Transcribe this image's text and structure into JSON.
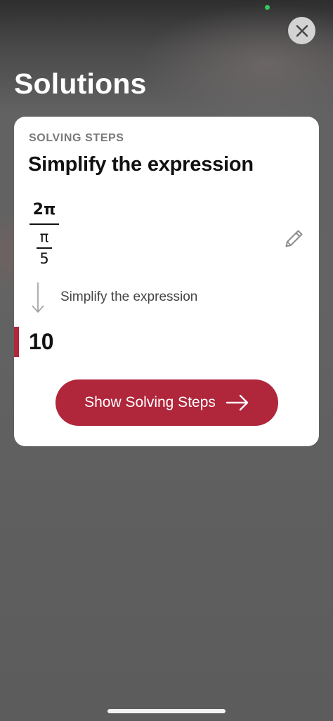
{
  "header": {
    "title": "Solutions",
    "close_icon": "close-icon"
  },
  "card": {
    "eyebrow": "SOLVING STEPS",
    "title": "Simplify the expression",
    "expression": {
      "numerator": "2π",
      "denominator_numerator": "π",
      "denominator_denominator": "5"
    },
    "edit_icon": "pencil-icon",
    "step": {
      "label": "Simplify the expression",
      "icon": "arrow-down-icon"
    },
    "result": "10",
    "cta": {
      "label": "Show Solving Steps",
      "icon": "arrow-right-icon"
    }
  },
  "colors": {
    "accent": "#b0263b",
    "status_dot": "#34c759",
    "background": "#5d5d5d",
    "card": "#ffffff"
  }
}
